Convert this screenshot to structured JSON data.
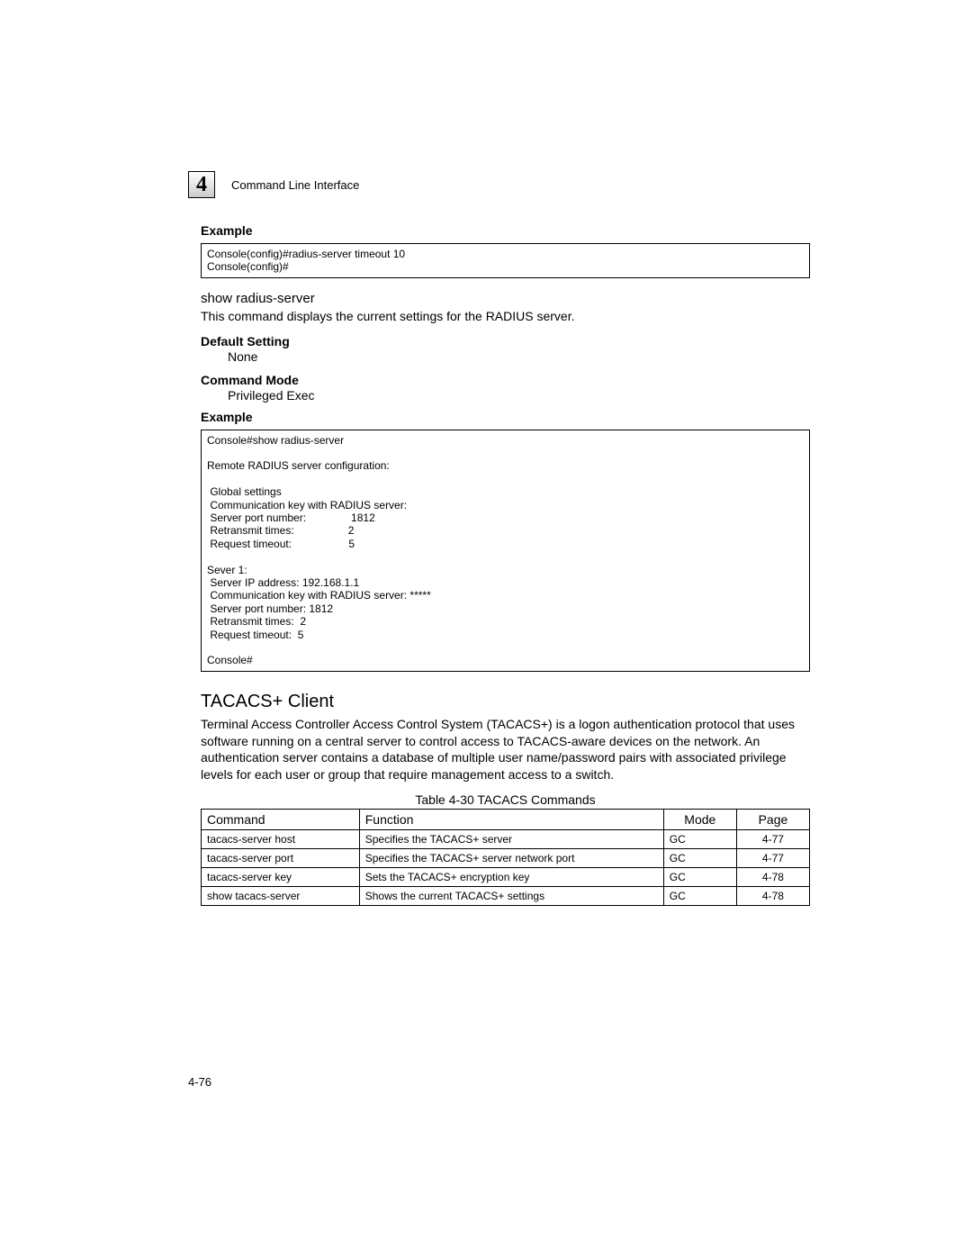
{
  "chapter": {
    "number": "4",
    "title": "Command Line Interface"
  },
  "sec1": {
    "title": "Example",
    "code": "Console(config)#radius-server timeout 10\nConsole(config)#"
  },
  "show_radius": {
    "heading": "show radius-server",
    "desc": "This command displays the current settings for the RADIUS server.",
    "default_label": "Default Setting",
    "default_value": "None",
    "mode_label": "Command Mode",
    "mode_value": "Privileged Exec",
    "example_label": "Example",
    "code": "Console#show radius-server\n\nRemote RADIUS server configuration:\n\n Global settings\n Communication key with RADIUS server:\n Server port number:               1812\n Retransmit times:                  2\n Request timeout:                   5\n\nSever 1:\n Server IP address: 192.168.1.1\n Communication key with RADIUS server: *****\n Server port number: 1812\n Retransmit times:  2\n Request timeout:  5\n\nConsole#"
  },
  "tacacs": {
    "heading": "TACACS+ Client",
    "desc": "Terminal Access Controller Access Control System (TACACS+) is a logon authentication protocol that uses software running on a central server to control access to TACACS-aware devices on the network. An authentication server contains a database of multiple user name/password pairs with associated privilege levels for each user or group that require management access to a switch."
  },
  "table": {
    "caption": "Table 4-30  TACACS Commands",
    "headers": {
      "c1": "Command",
      "c2": "Function",
      "c3": "Mode",
      "c4": "Page"
    },
    "rows": [
      {
        "c1": "tacacs-server host",
        "c2": "Specifies the TACACS+ server",
        "c3": "GC",
        "c4": "4-77"
      },
      {
        "c1": "tacacs-server port",
        "c2": "Specifies the TACACS+ server network port",
        "c3": "GC",
        "c4": "4-77"
      },
      {
        "c1": "tacacs-server key",
        "c2": "Sets the TACACS+ encryption key",
        "c3": "GC",
        "c4": "4-78"
      },
      {
        "c1": "show tacacs-server",
        "c2": "Shows the current TACACS+ settings",
        "c3": "GC",
        "c4": "4-78"
      }
    ]
  },
  "page_num": "4-76"
}
